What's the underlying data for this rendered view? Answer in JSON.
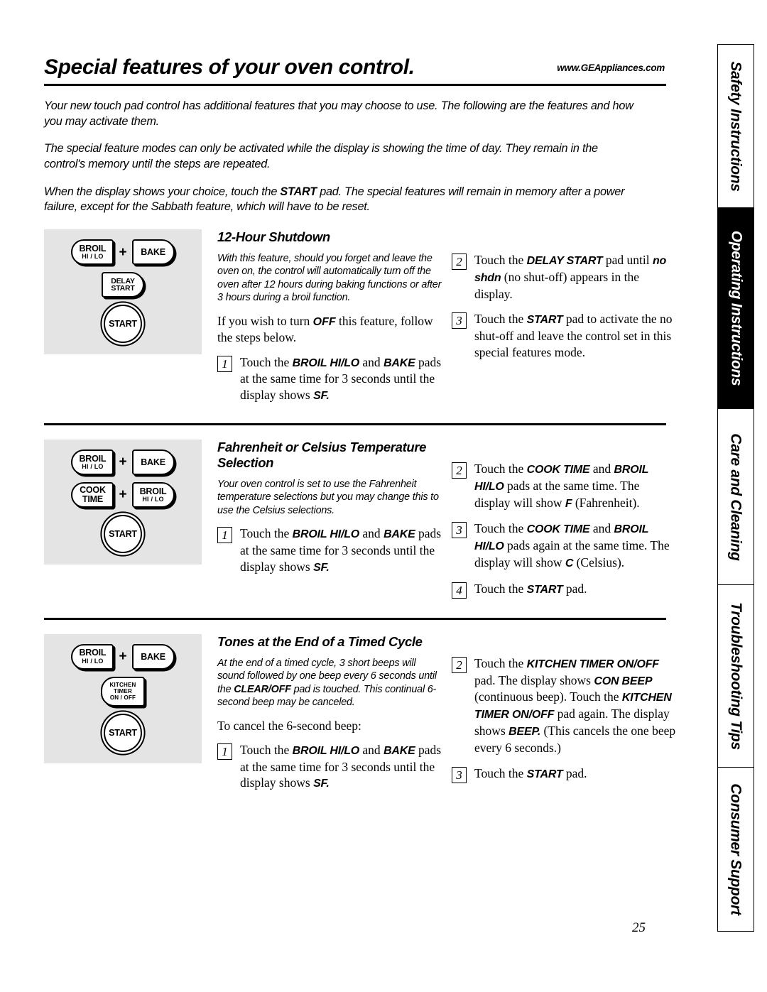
{
  "header": {
    "title": "Special features of your oven control.",
    "url": "www.GEAppliances.com"
  },
  "intro": {
    "p1": "Your new touch pad control has additional features that you may choose to use. The following are the features and how you may activate them.",
    "p2": "The special feature modes can only be activated while the display is showing the time of day. They remain in the control's memory until the steps are repeated.",
    "p3_a": "When the display shows your choice, touch the ",
    "p3_b": "START",
    "p3_c": " pad. The special features will remain in memory after a power failure, except for the Sabbath feature, which will have to be reset."
  },
  "sections": [
    {
      "heading": "12-Hour Shutdown",
      "blurb": "With this feature, should you forget and leave the oven on, the control will automatically turn off the oven after 12 hours during baking functions or after 3 hours during a broil function.",
      "lead_a": "If you wish to turn ",
      "lead_b": "OFF",
      "lead_c": " this feature, follow the steps below.",
      "pads": [
        {
          "label1": "BROIL",
          "label2": "HI / LO",
          "shape": "round-left"
        },
        {
          "label1": "BAKE",
          "shape": "round-right"
        },
        {
          "label1": "DELAY",
          "label2": "START",
          "shape": "round-right"
        },
        {
          "label1": "START",
          "shape": "circle"
        }
      ],
      "plus": "+",
      "steps_left": [
        {
          "num": "1",
          "t1": "Touch the ",
          "b1": "BROIL HI/LO",
          "t2": " and ",
          "b2": "BAKE",
          "t3": " pads at the same time for 3 seconds until the display shows ",
          "b3": "SF.",
          "t4": ""
        }
      ],
      "steps_right": [
        {
          "num": "2",
          "t1": "Touch the ",
          "b1": "DELAY START",
          "t2": " pad until ",
          "b2": "no shdn",
          "t3": " (no shut-off) appears in the display.",
          "b3": "",
          "t4": ""
        },
        {
          "num": "3",
          "t1": "Touch the ",
          "b1": "START",
          "t2": " pad to activate the no shut-off and leave the control set in this special features mode.",
          "b2": "",
          "t3": "",
          "b3": "",
          "t4": ""
        }
      ]
    },
    {
      "heading": "Fahrenheit or Celsius Temperature Selection",
      "blurb": "Your oven control is set to use the Fahrenheit temperature selections but you may change this to use the Celsius selections.",
      "lead_a": "",
      "lead_b": "",
      "lead_c": "",
      "pads": [
        {
          "label1": "BROIL",
          "label2": "HI / LO",
          "shape": "round-left"
        },
        {
          "label1": "BAKE",
          "shape": "round-right"
        },
        {
          "label1": "COOK",
          "label2": "TIME",
          "shape": "round-left"
        },
        {
          "label1": "BROIL",
          "label2": "HI / LO",
          "shape": "round-right"
        },
        {
          "label1": "START",
          "shape": "circle"
        }
      ],
      "plus": "+",
      "steps_left": [
        {
          "num": "1",
          "t1": "Touch the ",
          "b1": "BROIL HI/LO",
          "t2": " and ",
          "b2": "BAKE",
          "t3": " pads at the same time for 3 seconds until the display shows ",
          "b3": "SF.",
          "t4": ""
        }
      ],
      "steps_right": [
        {
          "num": "2",
          "t1": "Touch the ",
          "b1": "COOK TIME",
          "t2": " and ",
          "b2": "BROIL HI/LO",
          "t3": " pads at the same time. The display will show ",
          "b3": "F",
          "t4": " (Fahrenheit)."
        },
        {
          "num": "3",
          "t1": "Touch the ",
          "b1": "COOK TIME",
          "t2": " and ",
          "b2": "BROIL HI/LO",
          "t3": " pads again at the same time. The display will show ",
          "b3": "C",
          "t4": " (Celsius)."
        },
        {
          "num": "4",
          "t1": "Touch the ",
          "b1": "START",
          "t2": " pad.",
          "b2": "",
          "t3": "",
          "b3": "",
          "t4": ""
        }
      ]
    },
    {
      "heading": "Tones at the End of a Timed Cycle",
      "blurb_a": "At the end of a timed cycle, 3 short beeps will sound followed by one beep every 6 seconds until the ",
      "blurb_b": "CLEAR/OFF",
      "blurb_c": " pad is touched. This continual 6-second beep may be canceled.",
      "lead_a": "To cancel the 6-second beep:",
      "lead_b": "",
      "lead_c": "",
      "pads": [
        {
          "label1": "BROIL",
          "label2": "HI / LO",
          "shape": "round-left"
        },
        {
          "label1": "BAKE",
          "shape": "round-right"
        },
        {
          "label1": "KITCHEN",
          "label2": "TIMER",
          "label3": "ON / OFF",
          "shape": "round-left"
        },
        {
          "label1": "START",
          "shape": "circle"
        }
      ],
      "plus": "+",
      "steps_left": [
        {
          "num": "1",
          "t1": "Touch the ",
          "b1": "BROIL HI/LO",
          "t2": " and ",
          "b2": "BAKE",
          "t3": " pads at the same time for 3 seconds until the display shows ",
          "b3": "SF.",
          "t4": ""
        }
      ],
      "steps_right": [
        {
          "num": "2",
          "t1": "Touch the ",
          "b1": "KITCHEN TIMER ON/OFF",
          "t2": " pad. The display shows ",
          "b2": "CON BEEP",
          "t3": " (continuous beep). Touch the ",
          "b3": "KITCHEN TIMER ON/OFF",
          "t4": " pad again. The display shows ",
          "b4": "BEEP.",
          "t5": " (This cancels the one beep every 6 seconds.)"
        },
        {
          "num": "3",
          "t1": "Touch the ",
          "b1": "START",
          "t2": " pad.",
          "b2": "",
          "t3": "",
          "b3": "",
          "t4": ""
        }
      ]
    }
  ],
  "sidebar": {
    "tabs": [
      {
        "label": "Safety Instructions",
        "active": false
      },
      {
        "label": "Operating Instructions",
        "active": true
      },
      {
        "label": "Care and Cleaning",
        "active": false
      },
      {
        "label": "Troubleshooting Tips",
        "active": false
      },
      {
        "label": "Consumer Support",
        "active": false
      }
    ]
  },
  "footer": {
    "page_number": "25"
  }
}
